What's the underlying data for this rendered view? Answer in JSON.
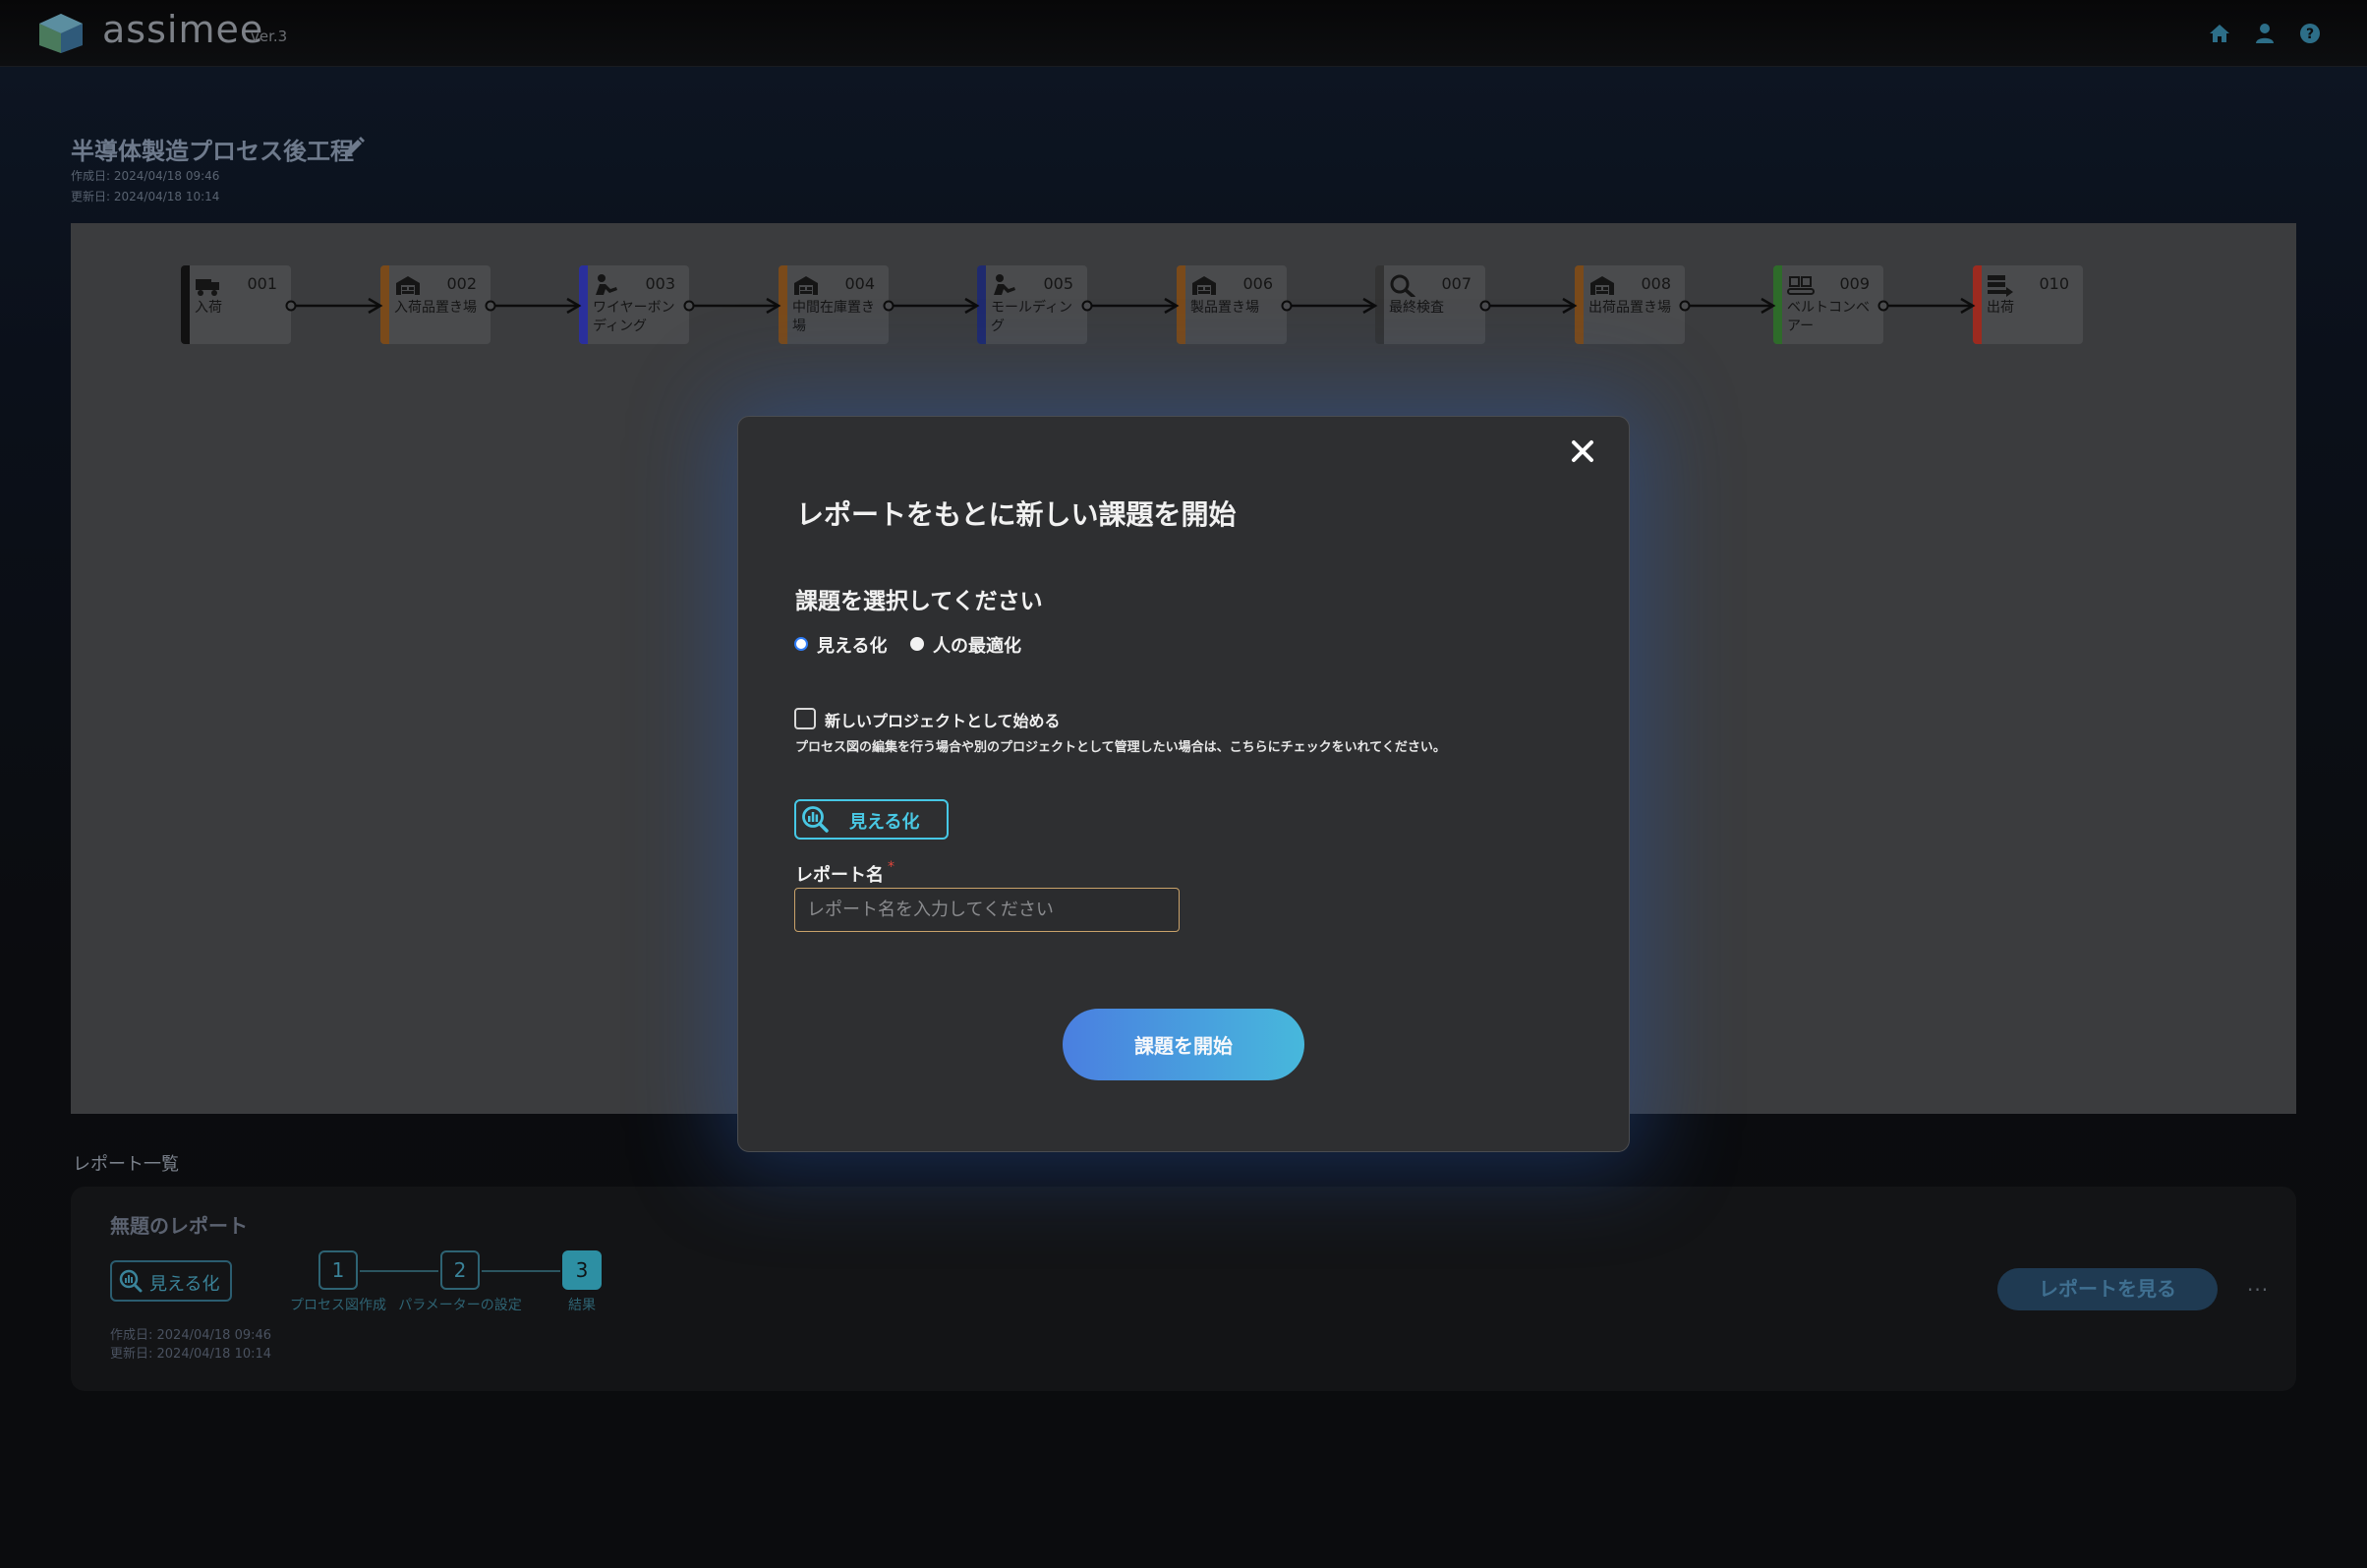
{
  "header": {
    "brand": "assimee",
    "version": "ver.3",
    "icons": [
      "home-icon",
      "user-icon",
      "help-icon"
    ]
  },
  "project": {
    "title": "半導体製造プロセス後工程",
    "created": "作成日: 2024/04/18 09:46",
    "updated": "更新日: 2024/04/18 10:14"
  },
  "process_nodes": [
    {
      "id": "001",
      "label": "入荷",
      "color": "#111111",
      "icon": "truck-icon"
    },
    {
      "id": "002",
      "label": "入荷品置き場",
      "color": "#7a4a1a",
      "icon": "warehouse-icon"
    },
    {
      "id": "003",
      "label": "ワイヤーボンディング",
      "color": "#2a2f9c",
      "icon": "worker-icon"
    },
    {
      "id": "004",
      "label": "中間在庫置き場",
      "color": "#7a4a1a",
      "icon": "warehouse-icon"
    },
    {
      "id": "005",
      "label": "モールディング",
      "color": "#1f2a6e",
      "icon": "worker-icon"
    },
    {
      "id": "006",
      "label": "製品置き場",
      "color": "#7a4a1a",
      "icon": "warehouse-icon"
    },
    {
      "id": "007",
      "label": "最終検査",
      "color": "#333333",
      "icon": "search-icon"
    },
    {
      "id": "008",
      "label": "出荷品置き場",
      "color": "#7a4a1a",
      "icon": "warehouse-icon"
    },
    {
      "id": "009",
      "label": "ベルトコンベアー",
      "color": "#2e6b2a",
      "icon": "conveyor-icon"
    },
    {
      "id": "010",
      "label": "出荷",
      "color": "#9c2a1f",
      "icon": "shipping-icon"
    }
  ],
  "report_list": {
    "title": "レポート一覧",
    "card": {
      "name": "無題のレポート",
      "tag": "見える化",
      "steps": [
        {
          "num": "1",
          "label": "プロセス図作成"
        },
        {
          "num": "2",
          "label": "パラメーターの設定"
        },
        {
          "num": "3",
          "label": "結果"
        }
      ],
      "active_step": 3,
      "created": "作成日: 2024/04/18 09:46",
      "updated": "更新日: 2024/04/18 10:14",
      "view_button": "レポートを見る",
      "more": "···"
    }
  },
  "modal": {
    "title": "レポートをもとに新しい課題を開始",
    "subtitle": "課題を選択してください",
    "options": [
      {
        "label": "見える化",
        "selected": true
      },
      {
        "label": "人の最適化",
        "selected": false
      }
    ],
    "checkbox_label": "新しいプロジェクトとして始める",
    "checkbox_checked": false,
    "checkbox_help": "プロセス図の編集を行う場合や別のプロジェクトとして管理したい場合は、こちらにチェックをいれてください。",
    "tag": "見える化",
    "field_label": "レポート名",
    "required_mark": "*",
    "field_placeholder": "レポート名を入力してください",
    "field_value": "",
    "submit": "課題を開始"
  },
  "colors": {
    "accent": "#46c8e6",
    "button_gradient_start": "#4a7fe0",
    "button_gradient_end": "#47b8dc",
    "required": "#e0473c"
  }
}
